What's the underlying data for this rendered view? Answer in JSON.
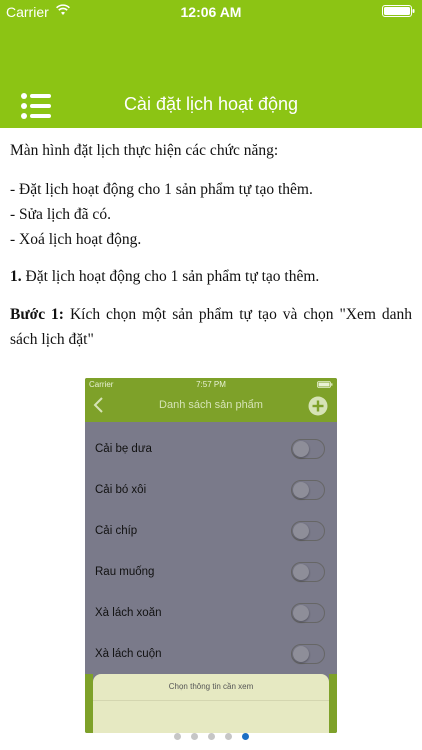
{
  "status_bar": {
    "carrier": "Carrier",
    "time": "12:06 AM"
  },
  "header": {
    "title": "Cài đặt lịch hoạt động",
    "menu_icon": "menu-list-icon",
    "color": "#8cc414"
  },
  "content": {
    "intro": "Màn hình đặt lịch thực hiện các chức năng:",
    "functions": [
      "- Đặt lịch hoạt động cho 1 sản phẩm tự tạo thêm.",
      "- Sửa lịch đã có.",
      "- Xoá lịch hoạt động."
    ],
    "section1_number": "1.",
    "section1_text": " Đặt lịch hoạt động cho 1 sản phẩm tự tạo thêm.",
    "step1_label": "Bước 1:",
    "step1_text": " Kích chọn một sản phẩm tự tạo và chọn \"Xem danh sách lịch đặt\""
  },
  "screenshot": {
    "carrier": "Carrier",
    "time": "7:57 PM",
    "title": "Danh sách sản phẩm",
    "items": [
      {
        "label": "Cải bẹ dưa",
        "on": false
      },
      {
        "label": "Cải bó xôi",
        "on": false
      },
      {
        "label": "Cải chíp",
        "on": false
      },
      {
        "label": "Rau muống",
        "on": false
      },
      {
        "label": "Xà lách xoăn",
        "on": false
      },
      {
        "label": "Xà lách cuộn",
        "on": false
      }
    ],
    "sheet_title": "Chọn thông tin cần xem"
  },
  "pager": {
    "count": 5,
    "active_index": 4,
    "active_color": "#1b6fc4"
  }
}
